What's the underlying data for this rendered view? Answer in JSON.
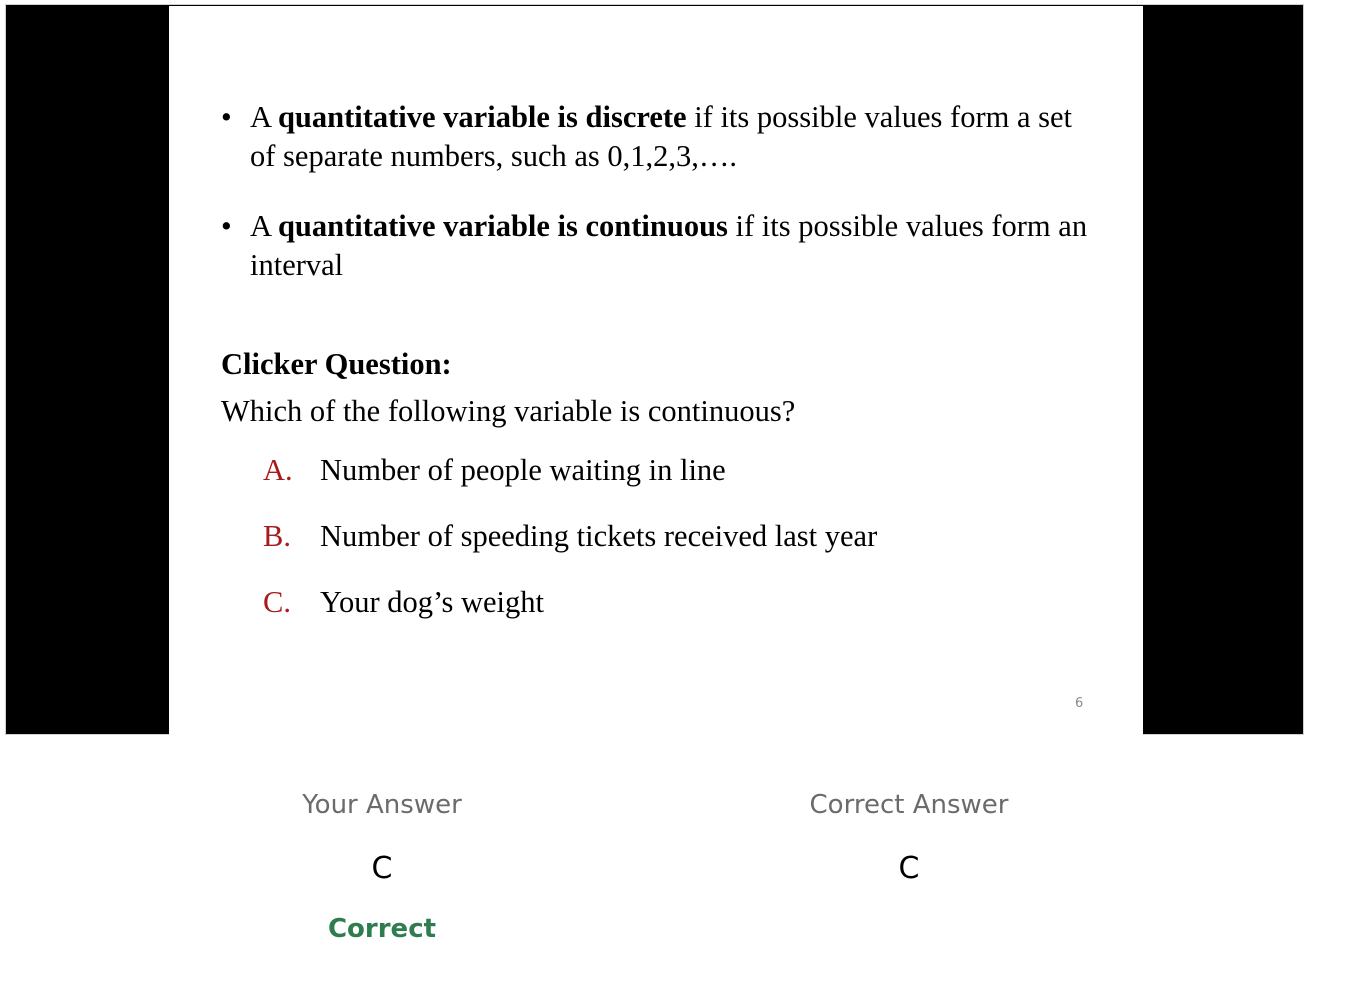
{
  "slide": {
    "bullet_symbol": "•",
    "bullets": [
      {
        "prefix": "A ",
        "bold": "quantitative variable is discrete",
        "suffix": " if its possible values form a set of separate numbers, such as 0,1,2,3,…."
      },
      {
        "prefix": "A ",
        "bold": "quantitative variable is continuous",
        "suffix": " if its possible values form an interval"
      }
    ],
    "question_heading": "Clicker Question:",
    "question_text": "Which of the following variable is continuous?",
    "options": [
      {
        "letter": "A.",
        "text": "Number of people waiting in line"
      },
      {
        "letter": "B.",
        "text": "Number of speeding tickets received last year"
      },
      {
        "letter": "C.",
        "text": "Your dog’s weight"
      }
    ],
    "page_number": "6"
  },
  "result": {
    "your_answer_label": "Your Answer",
    "your_answer_value": "C",
    "status": "Correct",
    "correct_answer_label": "Correct Answer",
    "correct_answer_value": "C"
  },
  "colors": {
    "option_letter": "#a61c1c",
    "status_correct": "#2e7d4f",
    "letterbox": "#000000"
  }
}
